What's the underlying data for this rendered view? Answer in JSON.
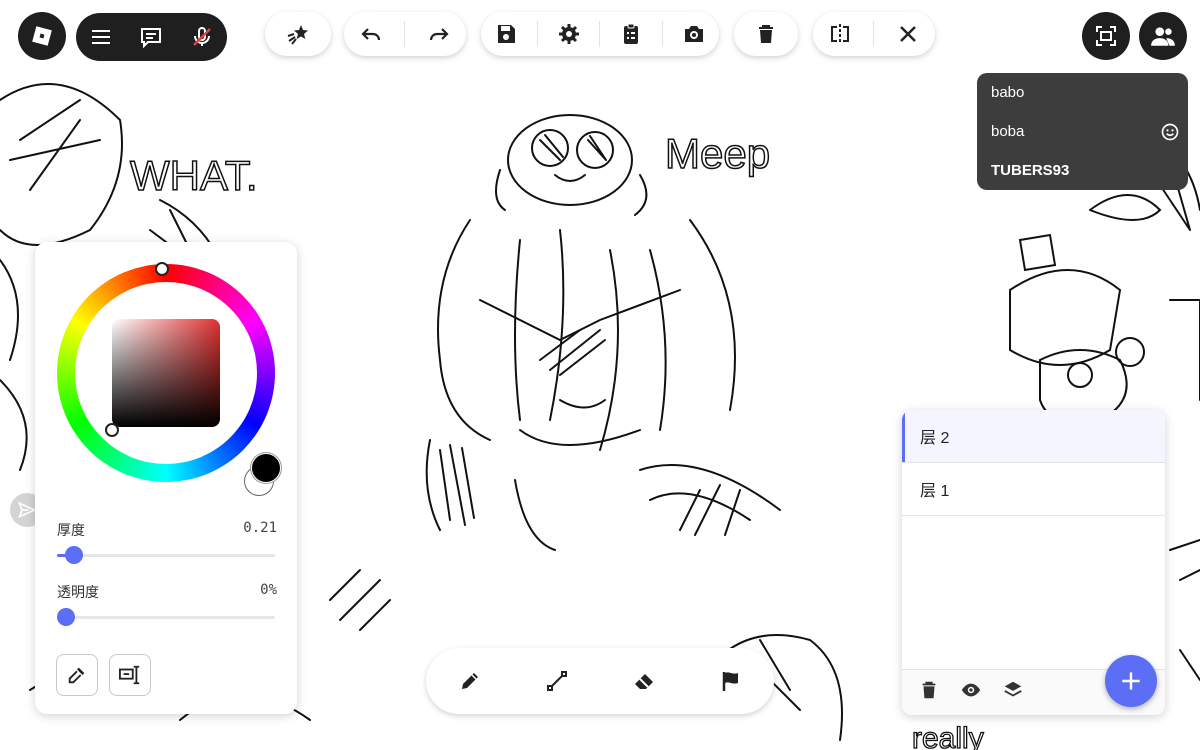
{
  "canvas_text": {
    "what": "WHAT.",
    "meep": "Meep",
    "really": "really"
  },
  "users": [
    {
      "name": "babo"
    },
    {
      "name": "boba"
    },
    {
      "name": "TUBERS93"
    }
  ],
  "color_panel": {
    "thickness_label": "厚度",
    "thickness_value": "0.21",
    "thickness_fraction": 0.08,
    "opacity_label": "透明度",
    "opacity_value": "0%",
    "opacity_fraction": 0.0,
    "current_color": "#000000"
  },
  "layers": [
    {
      "label": "层 2",
      "active": true
    },
    {
      "label": "层 1",
      "active": false
    }
  ],
  "colors": {
    "accent": "#5b6ef5",
    "toolbar_dark": "#1f1f1f",
    "users_panel": "#3d3d3d"
  }
}
